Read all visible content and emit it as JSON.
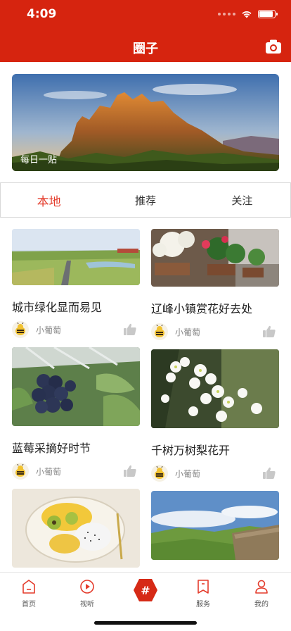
{
  "status_bar": {
    "time": "4:09"
  },
  "header": {
    "title": "圈子"
  },
  "banner": {
    "label": "每日一贴"
  },
  "tabs": [
    {
      "label": "本地",
      "active": true
    },
    {
      "label": "推荐",
      "active": false
    },
    {
      "label": "关注",
      "active": false
    }
  ],
  "posts": [
    {
      "title": "城市绿化显而易见",
      "author": "小葡萄"
    },
    {
      "title": "辽峰小镇赏花好去处",
      "author": "小葡萄"
    },
    {
      "title": "蓝莓采摘好时节",
      "author": "小葡萄"
    },
    {
      "title": "千树万树梨花开",
      "author": "小葡萄"
    }
  ],
  "bottom_nav": [
    {
      "label": "首页"
    },
    {
      "label": "视听"
    },
    {
      "label": "#"
    },
    {
      "label": "服务"
    },
    {
      "label": "我的"
    }
  ],
  "colors": {
    "brand_red": "#d6240f",
    "tab_active": "#e43c2c"
  }
}
